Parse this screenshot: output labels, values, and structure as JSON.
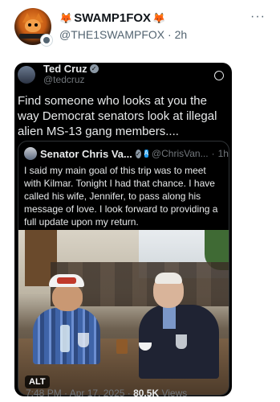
{
  "post": {
    "display_name": "SWAMP1FOX",
    "handle": "@THE1SWAMPFOX",
    "separator": "·",
    "time": "2h",
    "more_glyph": "···"
  },
  "quoted": {
    "name": "Ted Cruz",
    "handle": "@tedcruz",
    "text": "Find someone who looks at you the way Democrat senators look at illegal alien MS-13 gang members....",
    "embedded": {
      "name": "Senator Chris Va...",
      "handle": "@ChrisVan...",
      "separator": "·",
      "time": "1h",
      "text": "I said my main goal of this trip was to meet with Kilmar. Tonight I had that chance. I have called his wife, Jennifer, to pass along his message of love. I look forward to providing a full update upon my return.",
      "alt_label": "ALT"
    },
    "footer": {
      "time": "7:48 PM · Apr 17, 2025 · ",
      "views": "80.5K",
      "views_label": " Views"
    }
  }
}
